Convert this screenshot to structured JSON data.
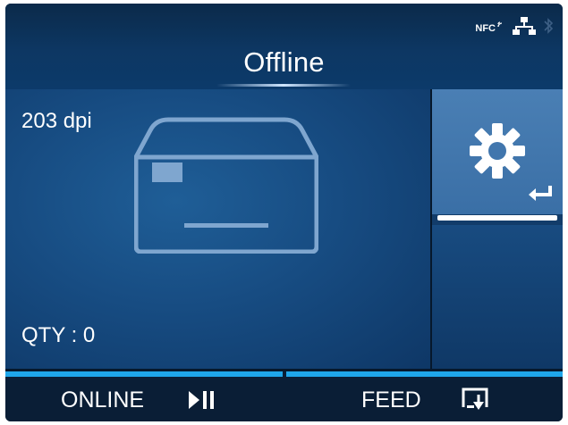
{
  "status_bar": {
    "nfc_label": "NFC",
    "icons": [
      "nfc-icon",
      "network-icon",
      "bluetooth-icon"
    ]
  },
  "header": {
    "title": "Offline"
  },
  "main": {
    "resolution": "203 dpi",
    "quantity": "QTY : 0",
    "illustration": "printer-icon"
  },
  "side": {
    "settings_icon": "gear-icon",
    "enter_icon": "enter-icon"
  },
  "softkeys": {
    "online_label": "ONLINE",
    "online_icon": "play-pause-icon",
    "feed_label": "FEED",
    "feed_icon": "feed-icon"
  },
  "colors": {
    "accent": "#1fa6ea",
    "screen_bg": "#06182c",
    "main_panel": "#174c82",
    "selected_tile": "#3a6fa6"
  }
}
